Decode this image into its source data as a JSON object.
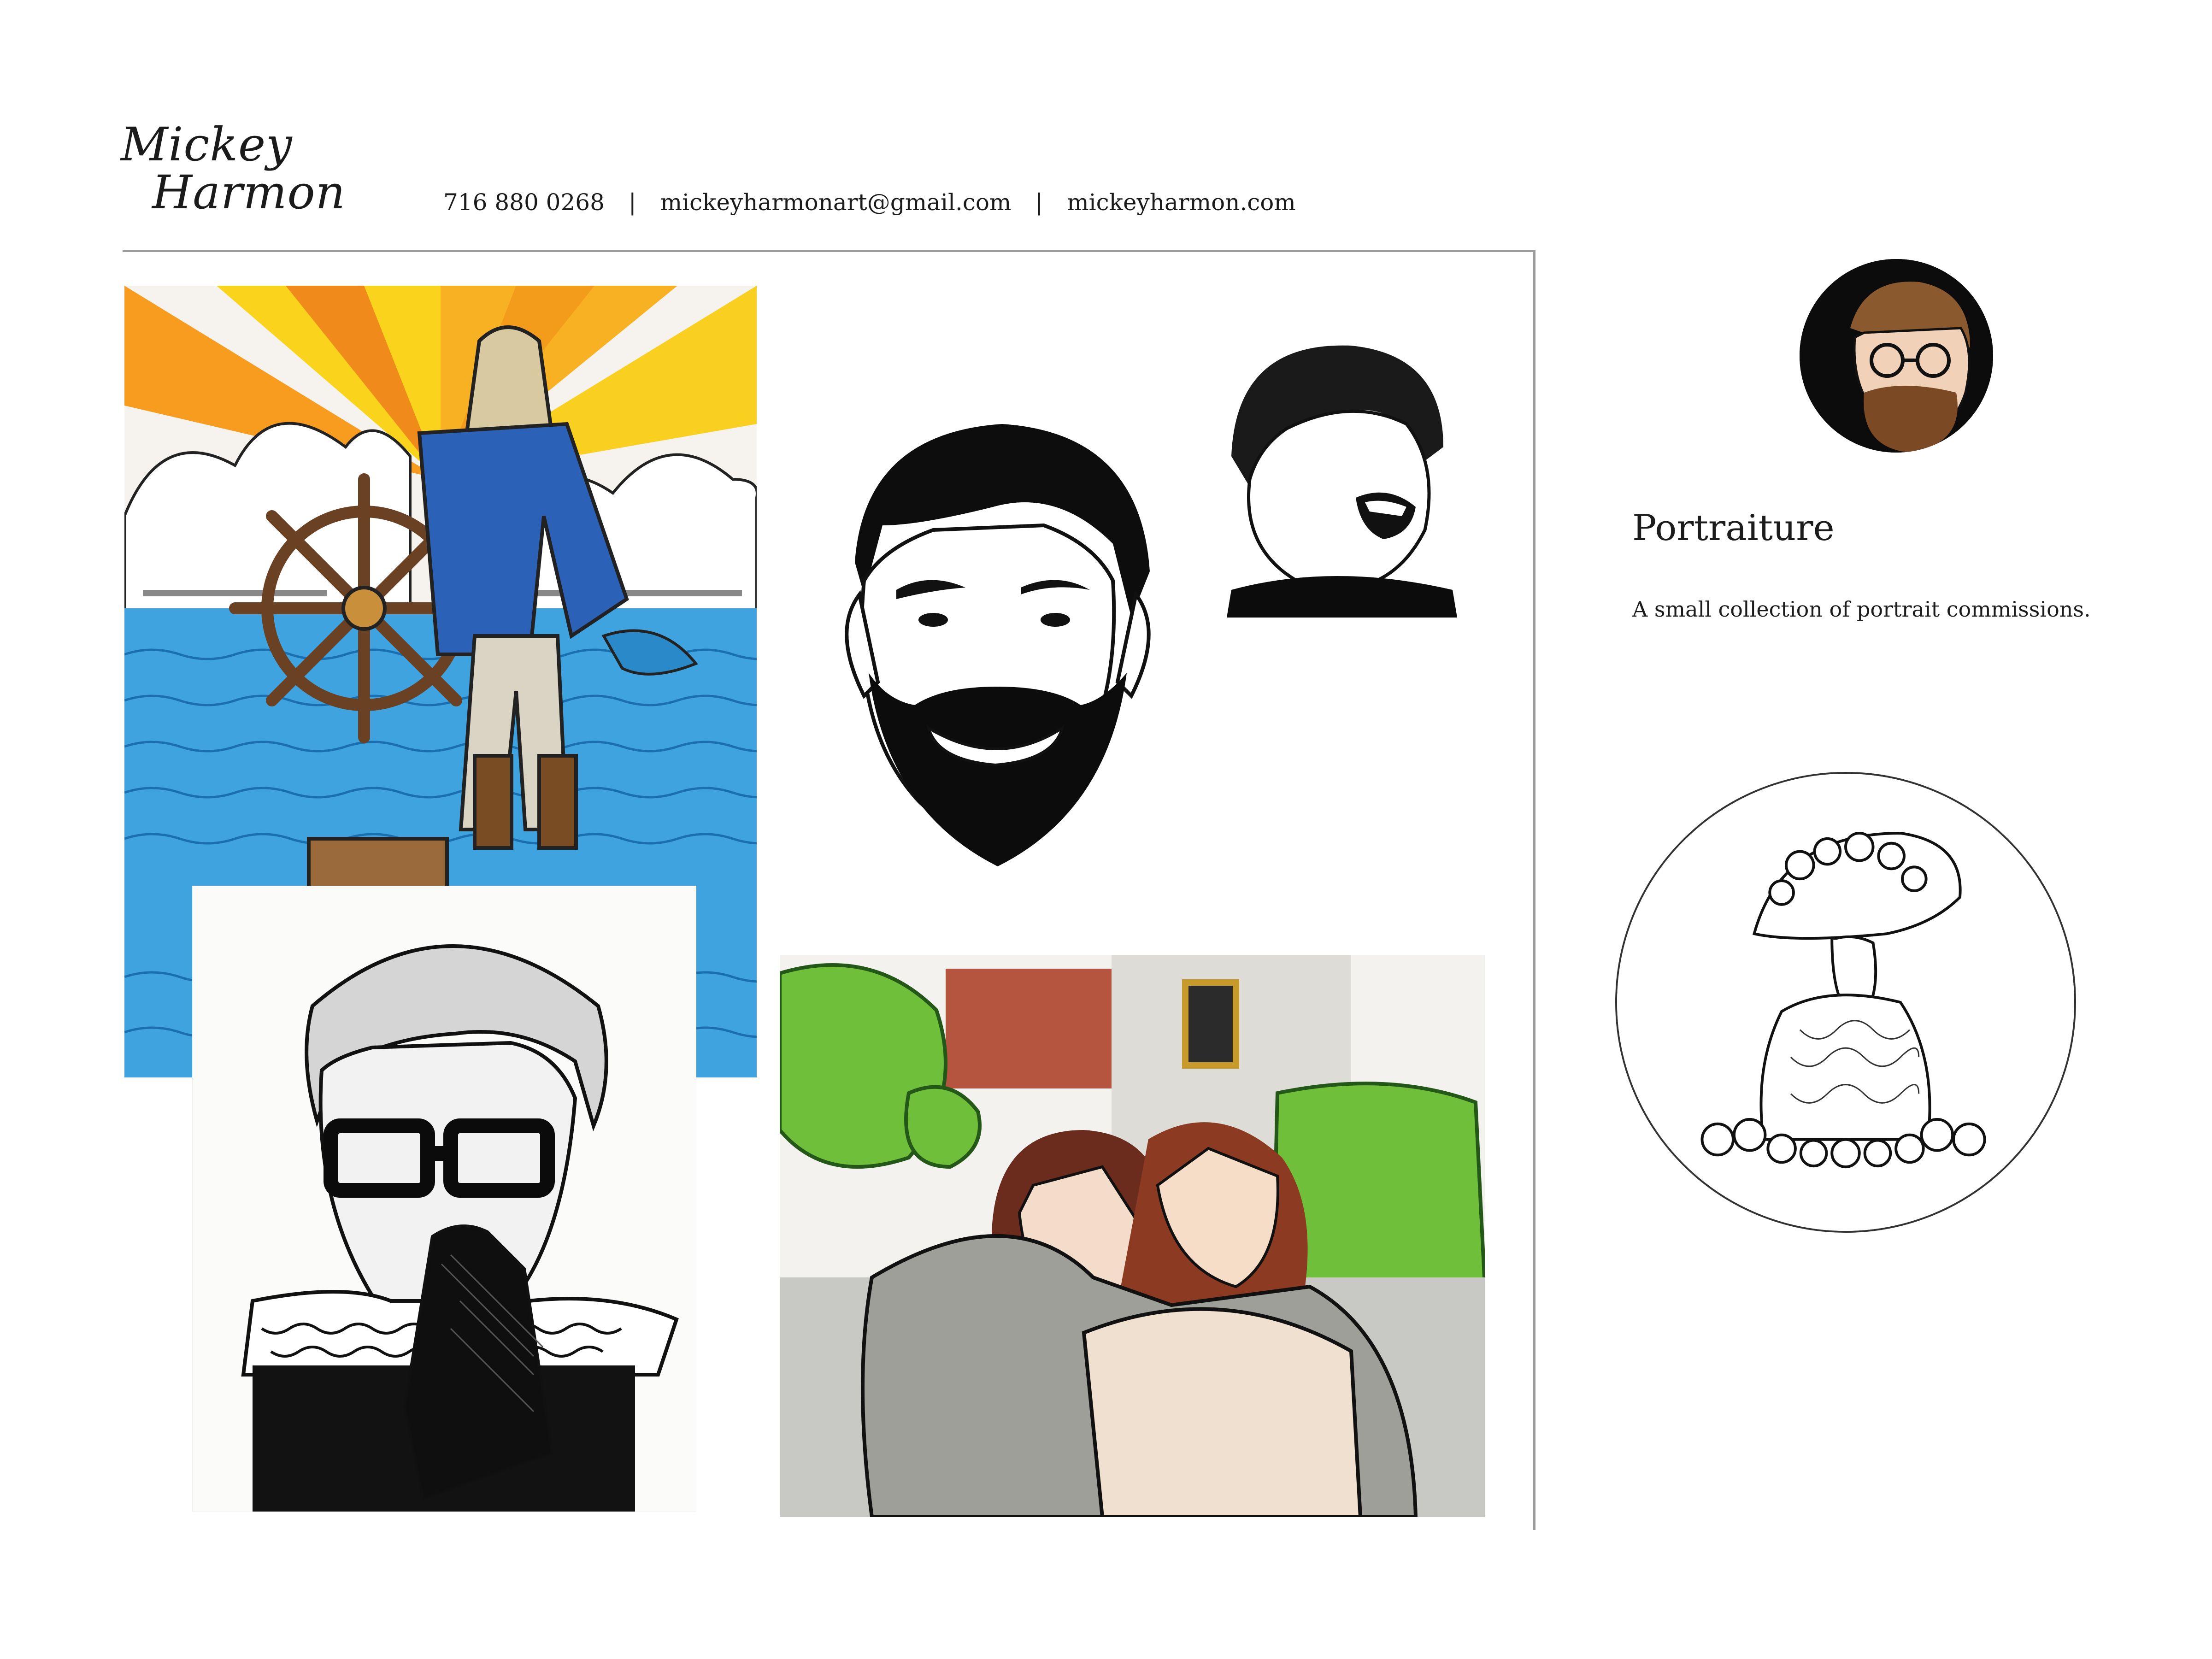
{
  "header": {
    "name_line1": "Mickey",
    "name_line2": "Harmon",
    "phone": "716 880 0268",
    "separator": "|",
    "email": "mickeyharmonart@gmail.com",
    "website": "mickeyharmon.com"
  },
  "section": {
    "title": "Portraiture",
    "description": "A small collection of portrait commissions."
  },
  "artworks": [
    {
      "name": "sailor-at-ship-wheel-illustration"
    },
    {
      "name": "bearded-man-portrait"
    },
    {
      "name": "laughing-boy-portrait"
    },
    {
      "name": "woman-with-glasses-and-lace-collar-portrait"
    },
    {
      "name": "embracing-couple-portrait"
    },
    {
      "name": "artist-self-portrait-avatar"
    },
    {
      "name": "woman-with-flowered-hat-medallion"
    }
  ],
  "colors": {
    "text": "#1c1c1c",
    "rule": "#9c9c9c",
    "sky_yellow": "#f7d21d",
    "sea_blue": "#3fa3e0"
  }
}
